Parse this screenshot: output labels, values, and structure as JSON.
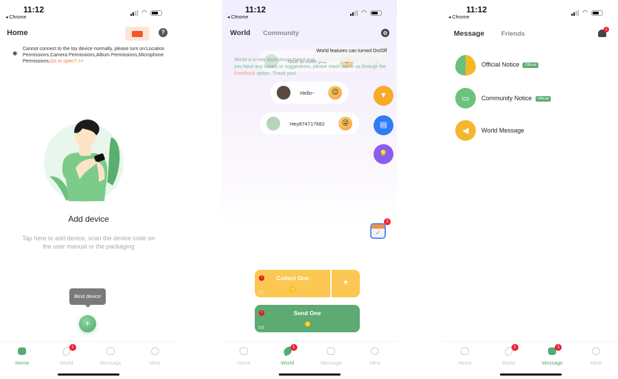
{
  "status_bar": {
    "time": "11:12",
    "back_app": "◂ Chrome"
  },
  "home_screen": {
    "title": "Home",
    "help_icon": "?",
    "warning": {
      "text": "Cannot connect to the toy device normally, please turn on:Location Permissions,Camera Permissions,Album Permissions,Microphone Permissions,",
      "link": "Go to open? >>"
    },
    "add_device_title": "Add device",
    "add_device_desc": "Tap here to add device, scan the device code on the user manual or the packaging",
    "bind_tooltip": "Bind device",
    "add_fab": "+"
  },
  "world_screen": {
    "tabs": [
      "World",
      "Community"
    ],
    "feature_tooltip": "World features can turned On/Off",
    "notice": {
      "text": "World is a new anonymous friend-making feature currently in testing! If you have any issues or suggestions, please reach out to us through the ",
      "link": "Feedback",
      "suffix": " option. Thank you!"
    },
    "bubbles": [
      {
        "text": "Nice to meet you",
        "emoji": "😋"
      },
      {
        "text": "Hello~",
        "emoji": "😌"
      },
      {
        "text": "Hey874717682",
        "emoji": "😜"
      }
    ],
    "side_buttons": [
      {
        "icon": "filter-icon",
        "glyph": "▼",
        "color": "#f7a928"
      },
      {
        "icon": "storage-icon",
        "glyph": "▤",
        "color": "#2f7df5"
      },
      {
        "icon": "bulb-icon",
        "glyph": "💡",
        "color": "#8a5cf0"
      }
    ],
    "calendar_badge": "1",
    "collect": {
      "label": "Collect One",
      "count": "2/2",
      "badge": "!"
    },
    "send": {
      "label": "Send One",
      "count": "3/3",
      "badge": "!"
    }
  },
  "message_screen": {
    "tabs": [
      "Message",
      "Friends"
    ],
    "bell_badge": "1",
    "items": [
      {
        "title": "Official Notice",
        "tag": "Official",
        "color": "#f5b825"
      },
      {
        "title": "Community Notice",
        "tag": "Official",
        "color": "#6cc37e"
      },
      {
        "title": "World Message",
        "tag": "",
        "color": "#f7b52d"
      }
    ]
  },
  "tabbar": {
    "items": [
      "Home",
      "World",
      "Message",
      "Mine"
    ],
    "world_badge": "1",
    "message_badge": "1"
  },
  "colors": {
    "accent_green": "#4fae6e",
    "orange": "#f07a35",
    "badge_red": "#ee2233"
  }
}
